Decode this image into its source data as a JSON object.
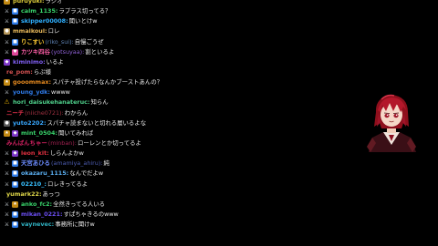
{
  "chat": {
    "messages": [
      {
        "badges": [
          "gold"
        ],
        "user": "puruyuki:",
        "user_color": "#d9c83a",
        "text": "ラジオ"
      },
      {
        "badges": [
          "sword",
          "blue"
        ],
        "user": "calm_1135:",
        "user_color": "#38d26a",
        "text": "ラプラス切ってる？"
      },
      {
        "badges": [
          "sword",
          "blue"
        ],
        "user": "skipper00008:",
        "user_color": "#2fb0ff",
        "text": "聞いとけw"
      },
      {
        "badges": [
          "tan"
        ],
        "user": "mmaikoul:",
        "user_color": "#e7b85a",
        "text": "ロレ"
      },
      {
        "badges": [
          "sword",
          "blue"
        ],
        "user": "りこすい",
        "user_color": "#ffcc33",
        "extra": "(riko_sui):",
        "extra_color": "#5c7fb0",
        "text": "自慢ごうぜ"
      },
      {
        "badges": [
          "sword",
          "pink"
        ],
        "user": "カツキ四谷",
        "user_color": "#ff5fa8",
        "extra": "(yotsuyaa):",
        "extra_color": "#8b5fd0",
        "text": "割といるよ"
      },
      {
        "badges": [
          "purple"
        ],
        "user": "kiminimo:",
        "user_color": "#7e5ef0",
        "text": "いるよ"
      },
      {
        "badges": [],
        "user": "re_pom:",
        "user_color": "#d05050",
        "text": "らぷ様"
      },
      {
        "badges": [
          "gold"
        ],
        "user": "gooommax:",
        "user_color": "#e68a1f",
        "text": "スパチャ投げたらなんかブーストあんの？"
      },
      {
        "badges": [
          "sword"
        ],
        "user": "young_ydk:",
        "user_color": "#2f7be8",
        "text": "wwww"
      },
      {
        "badges": [
          "warn"
        ],
        "user": "hori_daisukehanateruc:",
        "user_color": "#4ecf8a",
        "text": "知らん"
      },
      {
        "badges": [],
        "user": "ニーチ",
        "user_color": "#e0304a",
        "extra": "(niiche0721):",
        "extra_color": "#a03040",
        "text": "わからん"
      },
      {
        "badges": [
          "gray"
        ],
        "user": "yuto2202:",
        "user_color": "#38a8ff",
        "text": "スパチャ読まないと切れる層いるよな"
      },
      {
        "badges": [
          "gold",
          "purple"
        ],
        "user": "mint_0504:",
        "user_color": "#38d26a",
        "text": "聞いてみれば"
      },
      {
        "badges": [],
        "user": "みんばんちゃー",
        "user_color": "#d02060",
        "extra": "(minban):",
        "extra_color": "#a02050",
        "text": "ローレンとか切ってるよ"
      },
      {
        "badges": [
          "sword",
          "purple"
        ],
        "user": "leon_kit:",
        "user_color": "#e03040",
        "text": "しらんよかw"
      },
      {
        "badges": [
          "sword",
          "blue"
        ],
        "user": "天宮あひる",
        "user_color": "#6c8cff",
        "extra": "(amamiya_ahiru):",
        "extra_color": "#4c5cb0",
        "text": "純"
      },
      {
        "badges": [
          "sword",
          "blue"
        ],
        "user": "okazaru_1115:",
        "user_color": "#5aaef0",
        "text": "なんでだよw"
      },
      {
        "badges": [
          "sword",
          "blue"
        ],
        "user": "02210_:",
        "user_color": "#38c0ff",
        "text": "ロレきってるよ"
      },
      {
        "badges": [],
        "user": "yumark22:",
        "user_color": "#e0d84a",
        "text": "あっつ"
      },
      {
        "badges": [
          "sword",
          "gold"
        ],
        "user": "anko_fc2:",
        "user_color": "#38d26a",
        "text": "全然きってる人いる"
      },
      {
        "badges": [
          "sword",
          "blue"
        ],
        "user": "mikan_0221:",
        "user_color": "#6a4ef0",
        "text": "すぱちゃきるのwww"
      },
      {
        "badges": [
          "sword",
          "blue"
        ],
        "user": "vaynevec:",
        "user_color": "#2fb0c0",
        "text": "事務所に聞けw"
      }
    ]
  },
  "avatar": {
    "label": "streamer-avatar"
  }
}
